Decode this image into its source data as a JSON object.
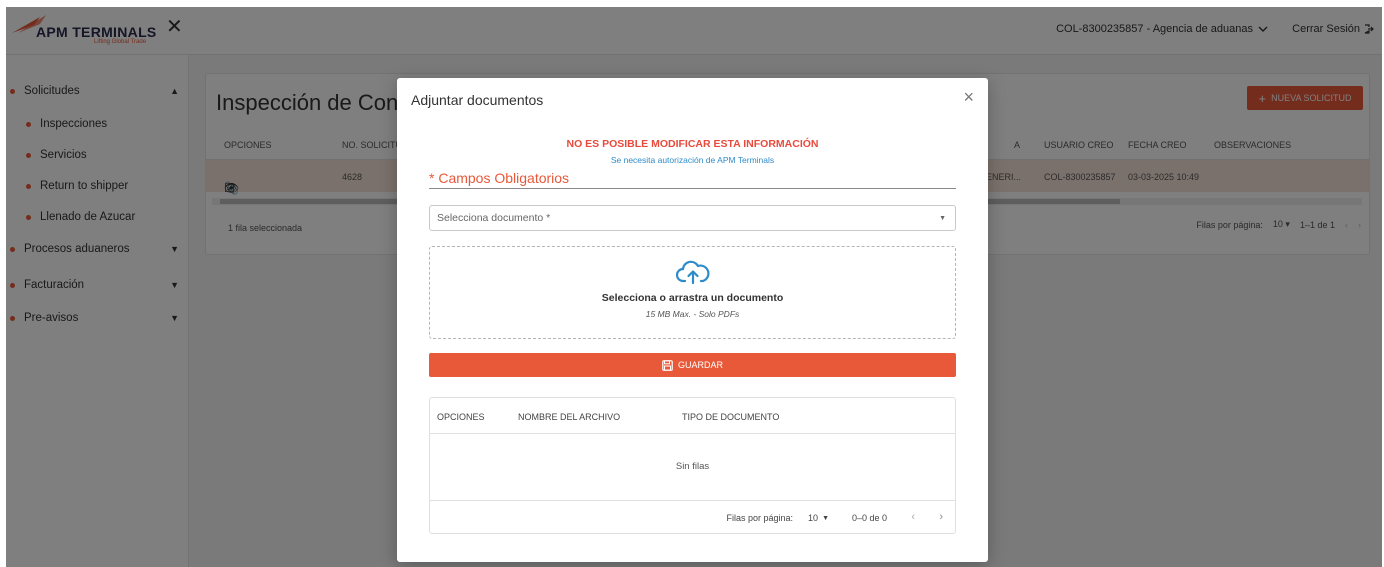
{
  "header": {
    "logo_text": "APM TERMINALS",
    "logo_tagline": "Lifting Global Trade",
    "close_glyph": "✕",
    "agency_label": "COL-8300235857 - Agencia de aduanas",
    "logout_label": "Cerrar Sesión"
  },
  "sidebar": {
    "items": [
      {
        "label": "Solicitudes",
        "level": 1,
        "caret": "up"
      },
      {
        "label": "Inspecciones",
        "level": 2
      },
      {
        "label": "Servicios",
        "level": 2
      },
      {
        "label": "Return to shipper",
        "level": 2
      },
      {
        "label": "Llenado de Azucar",
        "level": 2
      },
      {
        "label": "Procesos aduaneros",
        "level": 1,
        "caret": "down"
      },
      {
        "label": "Facturación",
        "level": 1,
        "caret": "down"
      },
      {
        "label": "Pre-avisos",
        "level": 1,
        "caret": "down"
      }
    ]
  },
  "main": {
    "title": "Inspección de Con",
    "new_button": "NUEVA SOLICITUD",
    "columns": [
      "OPCIONES",
      "NO. SOLICITU",
      "A",
      "USUARIO CREO",
      "FECHA CREO",
      "OBSERVACIONES"
    ],
    "row": {
      "no_solicitud": "4628",
      "partial": "ENERI...",
      "usuario": "COL-8300235857",
      "fecha": "03-03-2025 10:49"
    },
    "selected_note": "1 fila seleccionada",
    "pager": {
      "label": "Filas por página:",
      "size": "10",
      "range": "1–1 de 1"
    }
  },
  "modal": {
    "title": "Adjuntar documentos",
    "warning": "NO ES POSIBLE MODIFICAR ESTA INFORMACIÓN",
    "warning_sub": "Se necesita autorización de APM Terminals",
    "required_label": "* Campos Obligatorios",
    "select_placeholder": "Selecciona documento *",
    "dropzone_title": "Selecciona o arrastra un documento",
    "dropzone_sub": "15 MB Max. - Solo PDFs",
    "save_label": "GUARDAR",
    "table": {
      "columns": [
        "OPCIONES",
        "NOMBRE DEL ARCHIVO",
        "TIPO DE DOCUMENTO"
      ],
      "empty": "Sin filas",
      "pager": {
        "label": "Filas por página:",
        "size": "10",
        "range": "0–0 de 0"
      }
    }
  },
  "colors": {
    "accent": "#e8593a",
    "warning": "#e84a3c",
    "info": "#2e8bc9"
  }
}
